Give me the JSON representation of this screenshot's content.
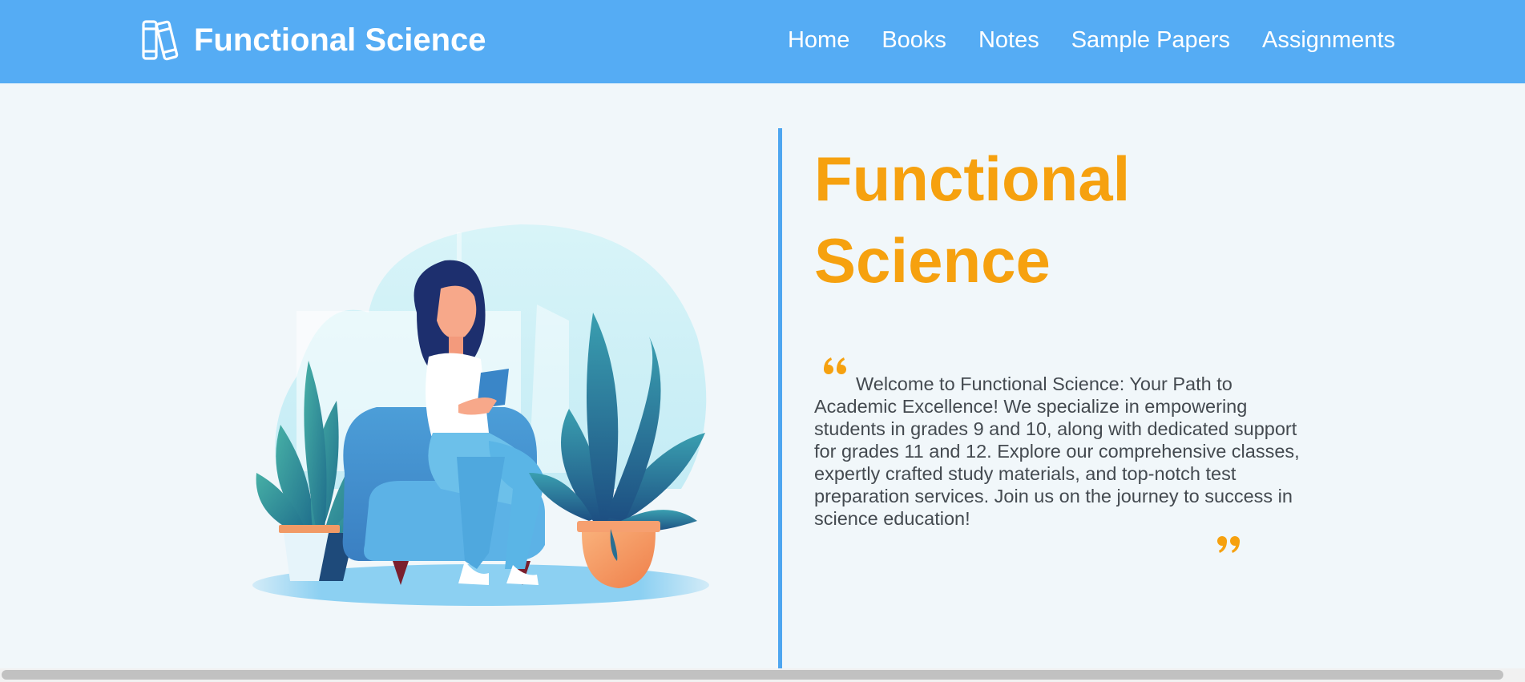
{
  "header": {
    "brand": "Functional Science",
    "brand_icon": "books-icon",
    "nav": [
      "Home",
      "Books",
      "Notes",
      "Sample Papers",
      "Assignments"
    ]
  },
  "hero": {
    "title": "Functional Science",
    "illustration": "woman-reading-illustration",
    "intro": "Welcome to Functional Science: Your Path to Academic Excellence! We specialize in empowering students in grades 9 and 10, along with dedicated support for grades 11 and 12. Explore our comprehensive classes, expertly crafted study materials, and top-notch test preparation services. Join us on the journey to success in science education!"
  },
  "colors": {
    "navbar": "#55acf4",
    "accent": "#f6a10f",
    "background": "#f1f7fa",
    "divider": "#4ea6f0",
    "body_text": "#444a50"
  }
}
